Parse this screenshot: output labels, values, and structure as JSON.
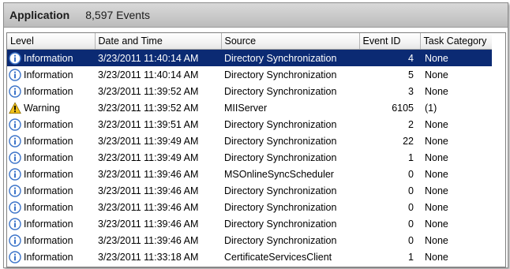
{
  "header": {
    "log_name": "Application",
    "event_count": "8,597 Events"
  },
  "columns": {
    "level": "Level",
    "date": "Date and Time",
    "source": "Source",
    "event_id": "Event ID",
    "category": "Task Category"
  },
  "colors": {
    "selection": "#0b2a73",
    "info_icon": "#3b73c9",
    "warning_icon": "#f2c21b"
  },
  "rows": [
    {
      "level": "Information",
      "icon": "info-icon",
      "date": "3/23/2011 11:40:14 AM",
      "source": "Directory Synchronization",
      "event_id": "4",
      "category": "None",
      "selected": true
    },
    {
      "level": "Information",
      "icon": "info-icon",
      "date": "3/23/2011 11:40:14 AM",
      "source": "Directory Synchronization",
      "event_id": "5",
      "category": "None"
    },
    {
      "level": "Information",
      "icon": "info-icon",
      "date": "3/23/2011 11:39:52 AM",
      "source": "Directory Synchronization",
      "event_id": "3",
      "category": "None"
    },
    {
      "level": "Warning",
      "icon": "warning-icon",
      "date": "3/23/2011 11:39:52 AM",
      "source": "MIIServer",
      "event_id": "6105",
      "category": "(1)"
    },
    {
      "level": "Information",
      "icon": "info-icon",
      "date": "3/23/2011 11:39:51 AM",
      "source": "Directory Synchronization",
      "event_id": "2",
      "category": "None"
    },
    {
      "level": "Information",
      "icon": "info-icon",
      "date": "3/23/2011 11:39:49 AM",
      "source": "Directory Synchronization",
      "event_id": "22",
      "category": "None"
    },
    {
      "level": "Information",
      "icon": "info-icon",
      "date": "3/23/2011 11:39:49 AM",
      "source": "Directory Synchronization",
      "event_id": "1",
      "category": "None"
    },
    {
      "level": "Information",
      "icon": "info-icon",
      "date": "3/23/2011 11:39:46 AM",
      "source": "MSOnlineSyncScheduler",
      "event_id": "0",
      "category": "None"
    },
    {
      "level": "Information",
      "icon": "info-icon",
      "date": "3/23/2011 11:39:46 AM",
      "source": "Directory Synchronization",
      "event_id": "0",
      "category": "None"
    },
    {
      "level": "Information",
      "icon": "info-icon",
      "date": "3/23/2011 11:39:46 AM",
      "source": "Directory Synchronization",
      "event_id": "0",
      "category": "None"
    },
    {
      "level": "Information",
      "icon": "info-icon",
      "date": "3/23/2011 11:39:46 AM",
      "source": "Directory Synchronization",
      "event_id": "0",
      "category": "None"
    },
    {
      "level": "Information",
      "icon": "info-icon",
      "date": "3/23/2011 11:39:46 AM",
      "source": "Directory Synchronization",
      "event_id": "0",
      "category": "None"
    },
    {
      "level": "Information",
      "icon": "info-icon",
      "date": "3/23/2011 11:33:18 AM",
      "source": "CertificateServicesClient",
      "event_id": "1",
      "category": "None"
    }
  ]
}
